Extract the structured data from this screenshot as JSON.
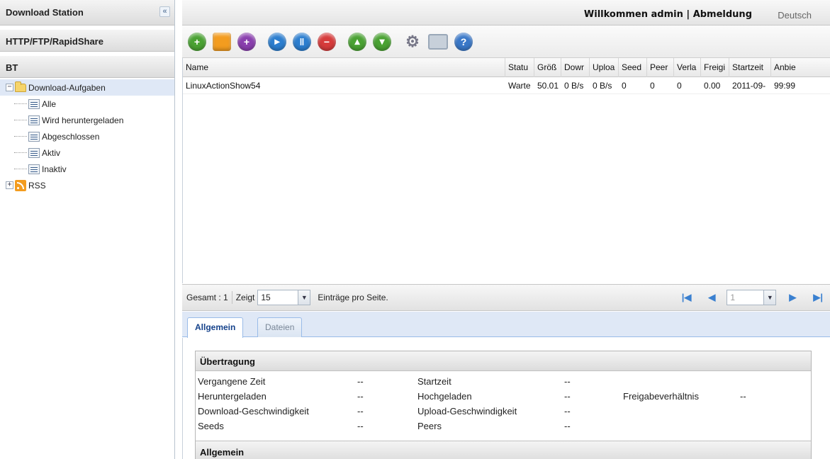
{
  "sidebar": {
    "title": "Download Station",
    "collapse_icon": "«",
    "section_http": "HTTP/FTP/RapidShare",
    "section_bt": "BT",
    "tree": {
      "root_label": "Download-Aufgaben",
      "children": [
        "Alle",
        "Wird heruntergeladen",
        "Abgeschlossen",
        "Aktiv",
        "Inaktiv"
      ],
      "rss_label": "RSS"
    }
  },
  "header": {
    "welcome": "Willkommen admin",
    "separator": "|",
    "logout": "Abmeldung",
    "language": "Deutsch"
  },
  "toolbar": {
    "icons": [
      "add-icon",
      "rss-add-icon",
      "add-task-icon",
      "resume-icon",
      "pause-icon",
      "stop-icon",
      "move-up-icon",
      "move-down-icon",
      "settings-icon",
      "monitor-icon",
      "help-icon"
    ]
  },
  "grid": {
    "columns": [
      "Name",
      "Statu",
      "Größ",
      "Dowr",
      "Uploa",
      "Seed",
      "Peer",
      "Verla",
      "Freigi",
      "Startzeit",
      "Anbie"
    ],
    "rows": [
      {
        "name": "LinuxActionShow54",
        "status": "Warte",
        "size": "50.01",
        "down": "0 B/s",
        "up": "0 B/s",
        "seed": "0",
        "peer": "0",
        "verl": "0",
        "frei": "0.00",
        "start": "2011-09-",
        "anb": "99:99"
      }
    ]
  },
  "pager": {
    "total": "Gesamt : 1",
    "show": "Zeigt",
    "per_page": "15",
    "entries_label": "Einträge pro Seite.",
    "page": "1"
  },
  "tabs": {
    "general": "Allgemein",
    "files": "Dateien"
  },
  "details": {
    "section_title": "Übertragung",
    "elapsed_label": "Vergangene Zeit",
    "elapsed": "--",
    "start_label": "Startzeit",
    "start": "--",
    "downloaded_label": "Heruntergeladen",
    "downloaded": "--",
    "uploaded_label": "Hochgeladen",
    "uploaded": "--",
    "ratio_label": "Freigabeverhältnis",
    "ratio": "--",
    "dl_speed_label": "Download-Geschwindigkeit",
    "dl_speed": "--",
    "ul_speed_label": "Upload-Geschwindigkeit",
    "ul_speed": "--",
    "seeds_label": "Seeds",
    "seeds": "--",
    "peers_label": "Peers",
    "peers": "--",
    "section2_title": "Allgemein"
  }
}
